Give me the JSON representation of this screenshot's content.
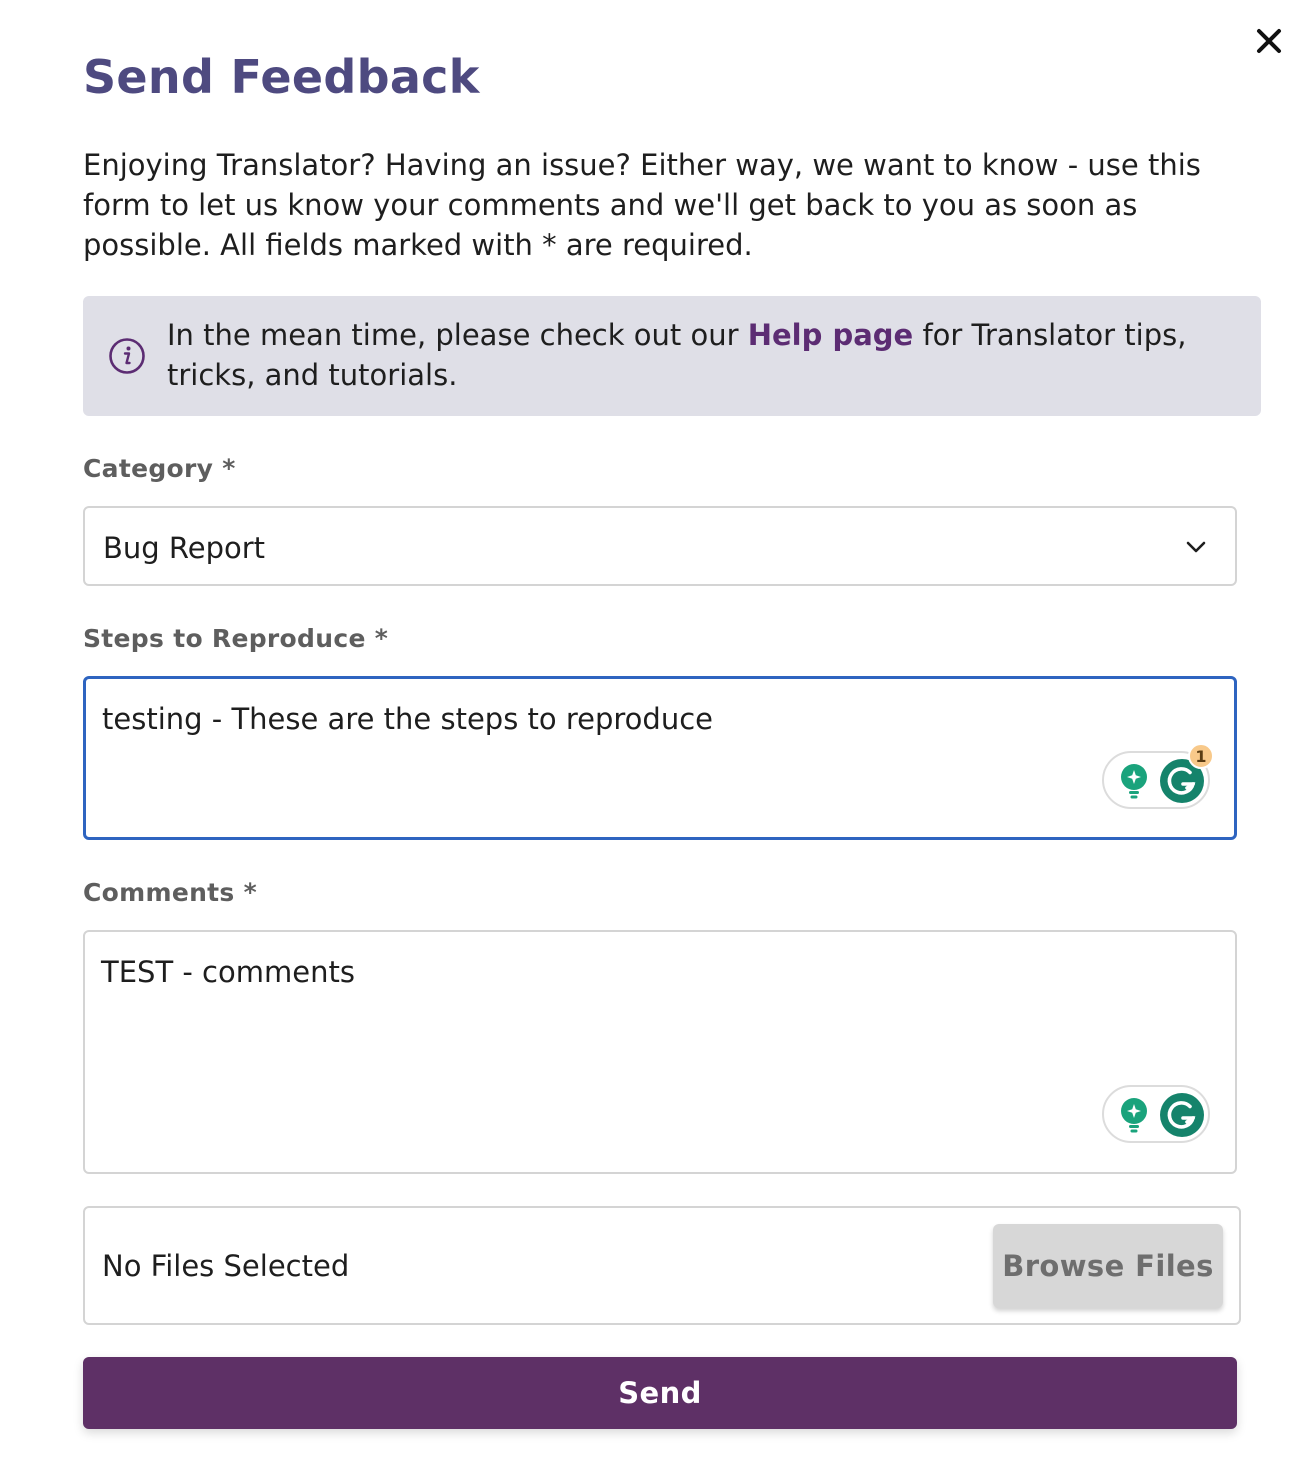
{
  "dialog": {
    "title": "Send Feedback",
    "intro": "Enjoying Translator? Having an issue? Either way, we want to know - use this form to let us know your comments and we'll get back to you as soon as possible. All fields marked with * are required.",
    "close_icon": "close-icon"
  },
  "info": {
    "icon": "info-icon",
    "text_before": "In the mean time, please check out our ",
    "link_label": "Help page",
    "text_after": " for Translator tips, tricks, and tutorials."
  },
  "category": {
    "label": "Category *",
    "selected": "Bug Report",
    "icon": "chevron-down-icon"
  },
  "steps": {
    "label": "Steps to Reproduce *",
    "value": "testing - These are the steps to reproduce",
    "grammarly_badge": "1"
  },
  "comments": {
    "label": "Comments *",
    "value": "TEST - comments"
  },
  "files": {
    "status": "No Files Selected",
    "browse_label": "Browse Files"
  },
  "actions": {
    "send_label": "Send"
  },
  "colors": {
    "title": "#4e4a80",
    "link": "#5c2c73",
    "send_button": "#5e3066",
    "focus_border": "#2e64c0",
    "info_background": "#dfdfe7",
    "grammarly_green": "#15836b"
  }
}
